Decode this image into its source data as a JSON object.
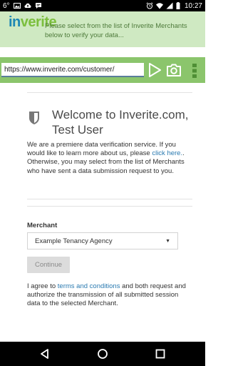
{
  "status_bar": {
    "temperature": "6°",
    "time": "10:27"
  },
  "header": {
    "logo_in": "in",
    "logo_verite": "verite",
    "message": "Please select from the list of Inverite Merchants below to verify your data..."
  },
  "url_bar": {
    "url": "https://www.inverite.com/customer/"
  },
  "content": {
    "welcome_title": "Welcome to Inverite.com, Test User",
    "intro_text_1": "We are a premiere data verification service. If you would like to learn more about us, please ",
    "intro_link": "click here.",
    "intro_text_2": ". Otherwise, you may select from the list of Merchants who have sent a data submission request to you.",
    "merchant_label": "Merchant",
    "merchant_selected": "Example Tenancy Agency",
    "continue_label": "Continue",
    "consent_text_1": "I agree to ",
    "consent_link": "terms and conditions",
    "consent_text_2": " and both request and authorize the transmission of all submitted session data to the selected Merchant."
  },
  "icons": {
    "shield": "shield-icon",
    "go": "play-arrow-icon",
    "camera": "camera-icon",
    "menu": "overflow-menu-icon"
  },
  "colors": {
    "header_bg": "#cfe9c2",
    "url_bar_bg": "#8bc56c",
    "link": "#2a7ab0"
  }
}
